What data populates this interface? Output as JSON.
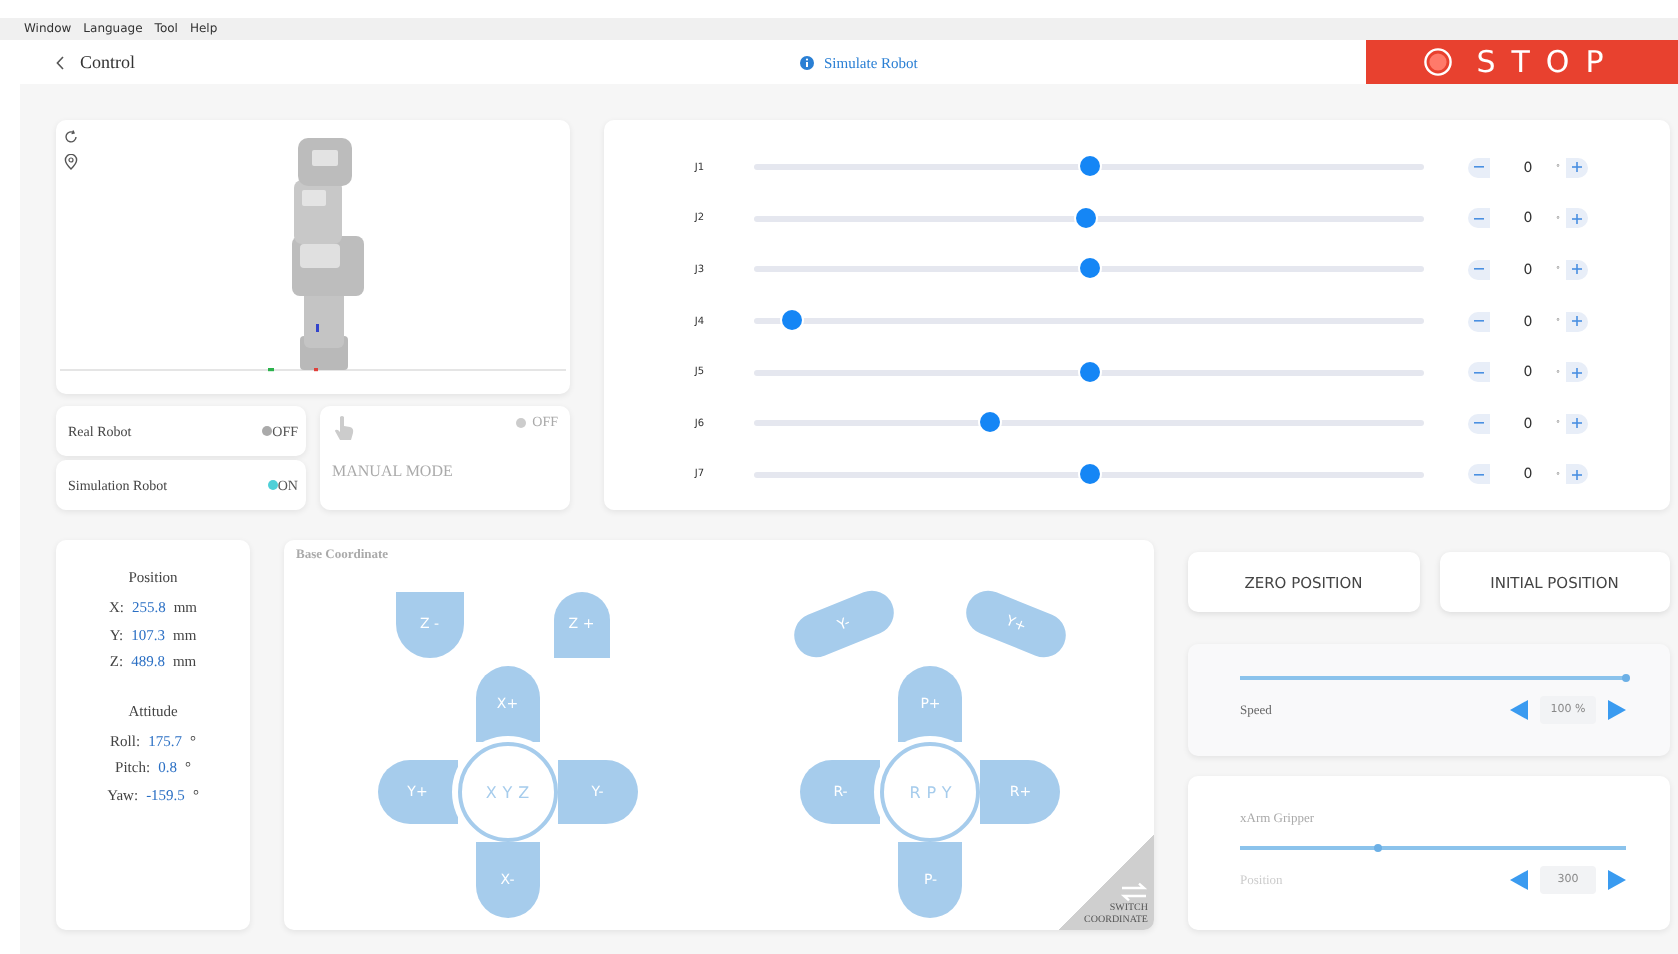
{
  "menu": [
    "Window",
    "Language",
    "Tool",
    "Help"
  ],
  "header": {
    "back_label": "Control",
    "mode": "Simulate Robot",
    "stop_label": "STOP"
  },
  "connections": [
    {
      "label": "Real Robot",
      "status": "OFF",
      "on": false
    },
    {
      "label": "Simulation Robot",
      "status": "ON",
      "on": true
    }
  ],
  "manual_mode": {
    "label": "MANUAL MODE",
    "status": "OFF",
    "on": false
  },
  "joints": [
    {
      "name": "J1",
      "level": 0.5,
      "value": "0",
      "unit": "°"
    },
    {
      "name": "J2",
      "level": 0.495,
      "value": "0",
      "unit": "°"
    },
    {
      "name": "J3",
      "level": 0.5,
      "value": "0",
      "unit": "°"
    },
    {
      "name": "J4",
      "level": 0.057,
      "value": "0",
      "unit": "°"
    },
    {
      "name": "J5",
      "level": 0.5,
      "value": "0",
      "unit": "°"
    },
    {
      "name": "J6",
      "level": 0.352,
      "value": "0",
      "unit": "°"
    },
    {
      "name": "J7",
      "level": 0.5,
      "value": "0",
      "unit": "°"
    }
  ],
  "position": {
    "title": "Position",
    "rows": [
      {
        "axis": "X:",
        "value": "255.8",
        "unit": "mm"
      },
      {
        "axis": "Y:",
        "value": "107.3",
        "unit": "mm"
      },
      {
        "axis": "Z:",
        "value": "489.8",
        "unit": "mm"
      }
    ]
  },
  "attitude": {
    "title": "Attitude",
    "rows": [
      {
        "axis": "Roll:",
        "value": "175.7",
        "unit": "°"
      },
      {
        "axis": "Pitch:",
        "value": "0.8",
        "unit": "°"
      },
      {
        "axis": "Yaw:",
        "value": "-159.5",
        "unit": "°"
      }
    ]
  },
  "coordinate": {
    "title": "Base Coordinate",
    "switch_label": "SWITCH COORDINATE",
    "pads": [
      {
        "kind": "caps",
        "center": "XYZ",
        "top_left": "Z -",
        "top_right": "Z +",
        "up": "X+",
        "left": "Y+",
        "right": "Y-",
        "down": "X-"
      },
      {
        "kind": "arcs",
        "center": "RPY",
        "top_left": "Y-",
        "top_right": "Y+",
        "up": "P+",
        "left": "R-",
        "right": "R+",
        "down": "P-"
      }
    ]
  },
  "presets": [
    "ZERO POSITION",
    "INITIAL POSITION"
  ],
  "speed": {
    "label": "Speed",
    "level": 1.0,
    "value": "100 %"
  },
  "gripper": {
    "title": "xArm Gripper",
    "label": "Position",
    "level": 0.36,
    "value": "300"
  }
}
